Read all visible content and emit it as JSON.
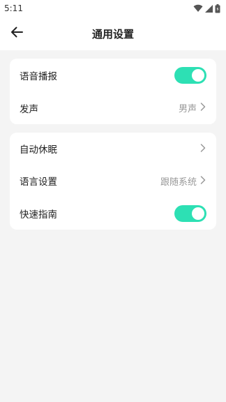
{
  "status_bar": {
    "time": "5:11",
    "icons": [
      "wifi-icon",
      "signal-icon",
      "battery-icon"
    ]
  },
  "header": {
    "title": "通用设置",
    "back_icon": "arrow-left-icon"
  },
  "colors": {
    "accent": "#2de0b4",
    "background": "#f4f4f4",
    "card": "#ffffff",
    "secondary_text": "#999999"
  },
  "settings": {
    "voice_broadcast": {
      "label": "语音播报",
      "enabled": true
    },
    "voice": {
      "label": "发声",
      "value": "男声"
    },
    "auto_sleep": {
      "label": "自动休眠"
    },
    "language": {
      "label": "语言设置",
      "value": "跟随系统"
    },
    "quick_guide": {
      "label": "快速指南",
      "enabled": true
    }
  }
}
